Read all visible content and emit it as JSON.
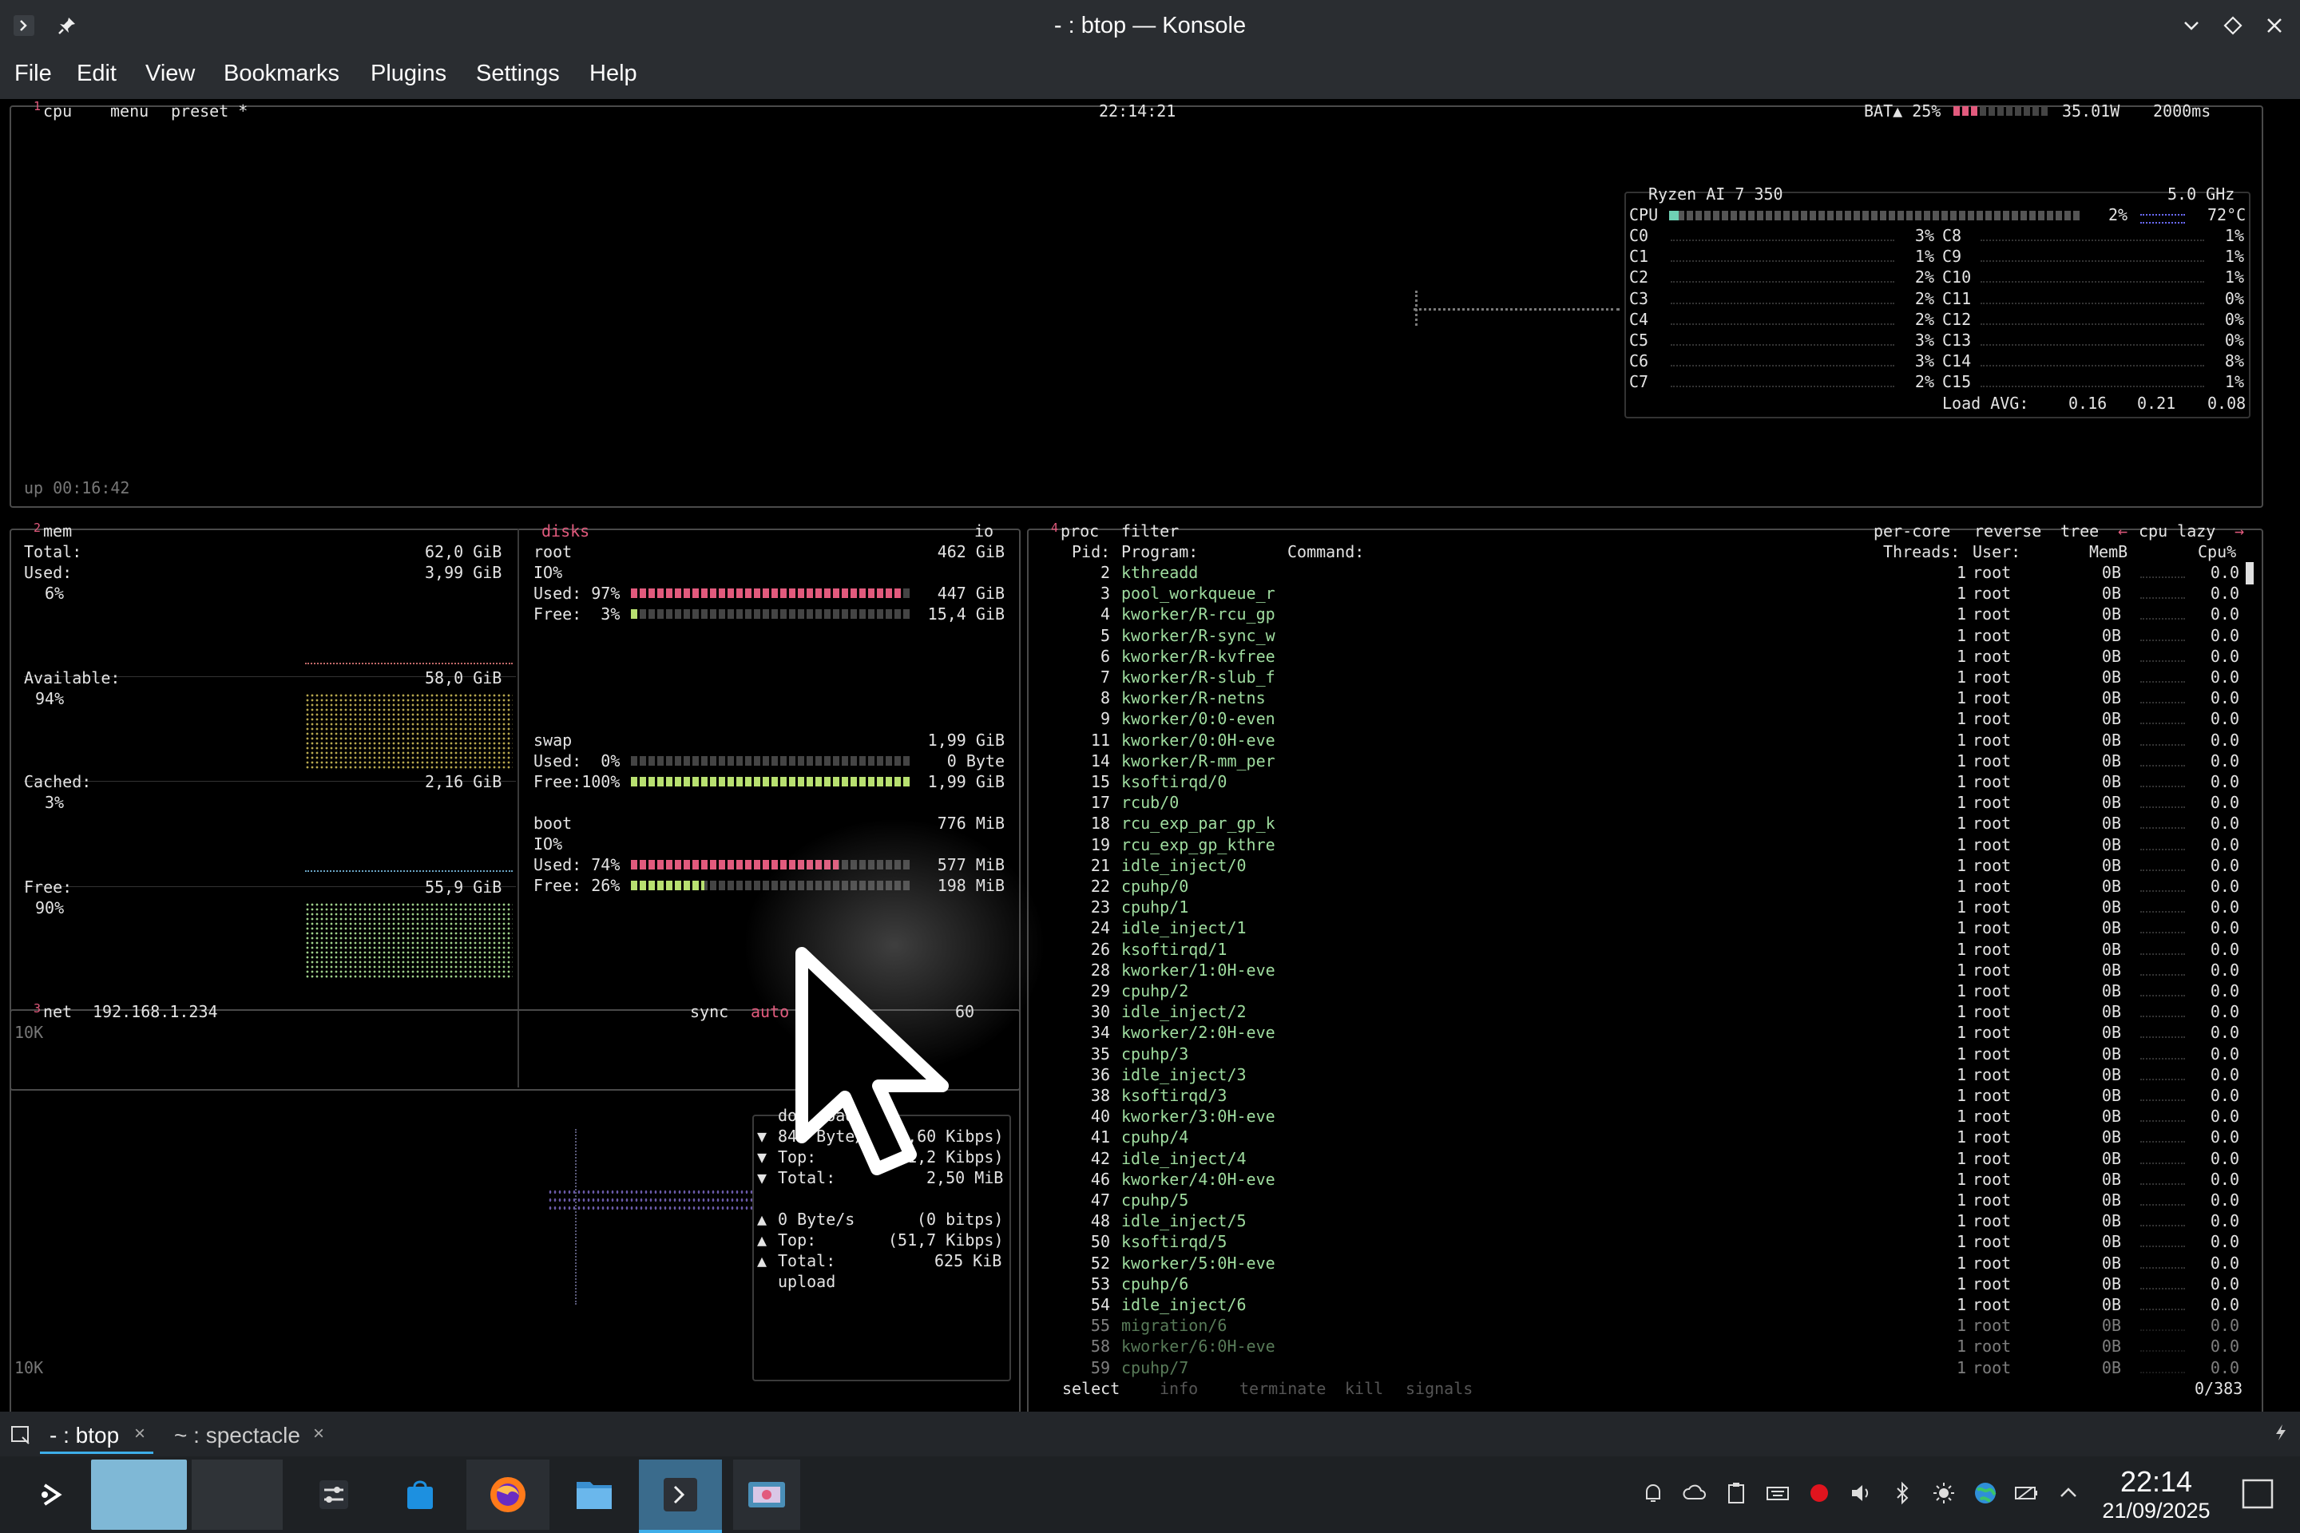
{
  "window": {
    "title": "- : btop — Konsole"
  },
  "menu": [
    "File",
    "Edit",
    "View",
    "Bookmarks",
    "Plugins",
    "Settings",
    "Help"
  ],
  "cpu": {
    "tab_num": "1",
    "tab": "cpu",
    "menu": "menu",
    "preset": "preset *",
    "clock": "22:14:21",
    "battery": "BAT▲ 25%",
    "battery_level": 0.25,
    "power": "35.01W",
    "interval": "2000ms",
    "uptime": "up 00:16:42",
    "model": "Ryzen AI 7 350",
    "freq": "5.0 GHz",
    "total_label": "CPU",
    "total_pct": "2%",
    "temp": "72°C",
    "cores_left": [
      {
        "name": "C0",
        "pct": "3%"
      },
      {
        "name": "C1",
        "pct": "1%"
      },
      {
        "name": "C2",
        "pct": "2%"
      },
      {
        "name": "C3",
        "pct": "2%"
      },
      {
        "name": "C4",
        "pct": "2%"
      },
      {
        "name": "C5",
        "pct": "3%"
      },
      {
        "name": "C6",
        "pct": "3%"
      },
      {
        "name": "C7",
        "pct": "2%"
      }
    ],
    "cores_right": [
      {
        "name": "C8",
        "pct": "1%"
      },
      {
        "name": "C9",
        "pct": "1%"
      },
      {
        "name": "C10",
        "pct": "1%"
      },
      {
        "name": "C11",
        "pct": "0%"
      },
      {
        "name": "C12",
        "pct": "0%"
      },
      {
        "name": "C13",
        "pct": "0%"
      },
      {
        "name": "C14",
        "pct": "8%"
      },
      {
        "name": "C15",
        "pct": "1%"
      }
    ],
    "load_label": "Load AVG:",
    "load": [
      "0.16",
      "0.21",
      "0.08"
    ]
  },
  "mem": {
    "tab_num": "2",
    "tab": "mem",
    "total_label": "Total:",
    "total": "62,0 GiB",
    "used_label": "Used:",
    "used": "3,99 GiB",
    "used_pct": "6%",
    "avail_label": "Available:",
    "avail": "58,0 GiB",
    "avail_pct": "94%",
    "cached_label": "Cached:",
    "cached": "2,16 GiB",
    "cached_pct": "3%",
    "free_label": "Free:",
    "free": "55,9 GiB",
    "free_pct": "90%"
  },
  "disks": {
    "tab": "disks",
    "io": "io",
    "root": {
      "name": "root",
      "size": "462 GiB",
      "io": "IO%",
      "used_label": "Used: 97%",
      "used": "447 GiB",
      "used_level": 0.97,
      "free_label": "Free:  3%",
      "free": "15,4 GiB",
      "free_level": 0.03
    },
    "swap": {
      "name": "swap",
      "size": "1,99 GiB",
      "used_label": "Used:  0%",
      "used": "0 Byte",
      "used_level": 0.0,
      "free_label": "Free:100%",
      "free": "1,99 GiB",
      "free_level": 1.0
    },
    "boot": {
      "name": "boot",
      "size": "776 MiB",
      "io": "IO%",
      "used_label": "Used: 74%",
      "used": "577 MiB",
      "used_level": 0.74,
      "free_label": "Free: 26%",
      "free": "198 MiB",
      "free_level": 0.26
    }
  },
  "net": {
    "tab_num": "3",
    "tab": "net",
    "ip": "192.168.1.234",
    "sync": "sync",
    "auto": "auto",
    "iface": "60",
    "scale_top": "10K",
    "scale_bottom": "10K",
    "download": {
      "label": "download",
      "rate": "845 Byte/s",
      "rate_bits": "(6,60 Kibps)",
      "top_label": "Top:",
      "top": "(31,2 Kibps)",
      "total_label": "Total:",
      "total": "2,50 MiB"
    },
    "upload": {
      "label": "upload",
      "rate": "0 Byte/s",
      "rate_bits": "(0 bitps)",
      "top_label": "Top:",
      "top": "(51,7 Kibps)",
      "total_label": "Total:",
      "total": "625 KiB"
    }
  },
  "proc": {
    "tab_num": "4",
    "tab": "proc",
    "filter": "filter",
    "per_core": "per-core",
    "reverse": "reverse",
    "tree": "tree",
    "sort": "cpu lazy",
    "headers": {
      "pid": "Pid:",
      "program": "Program:",
      "command": "Command:",
      "threads": "Threads:",
      "user": "User:",
      "mem": "MemB",
      "cpu": "Cpu%"
    },
    "rows": [
      {
        "pid": "2",
        "prog": "kthreadd",
        "thr": "1",
        "user": "root",
        "mem": "0B",
        "cpu": "0.0"
      },
      {
        "pid": "3",
        "prog": "pool_workqueue_r",
        "thr": "1",
        "user": "root",
        "mem": "0B",
        "cpu": "0.0"
      },
      {
        "pid": "4",
        "prog": "kworker/R-rcu_gp",
        "thr": "1",
        "user": "root",
        "mem": "0B",
        "cpu": "0.0"
      },
      {
        "pid": "5",
        "prog": "kworker/R-sync_w",
        "thr": "1",
        "user": "root",
        "mem": "0B",
        "cpu": "0.0"
      },
      {
        "pid": "6",
        "prog": "kworker/R-kvfree",
        "thr": "1",
        "user": "root",
        "mem": "0B",
        "cpu": "0.0"
      },
      {
        "pid": "7",
        "prog": "kworker/R-slub_f",
        "thr": "1",
        "user": "root",
        "mem": "0B",
        "cpu": "0.0"
      },
      {
        "pid": "8",
        "prog": "kworker/R-netns",
        "thr": "1",
        "user": "root",
        "mem": "0B",
        "cpu": "0.0"
      },
      {
        "pid": "9",
        "prog": "kworker/0:0-even",
        "thr": "1",
        "user": "root",
        "mem": "0B",
        "cpu": "0.0"
      },
      {
        "pid": "11",
        "prog": "kworker/0:0H-eve",
        "thr": "1",
        "user": "root",
        "mem": "0B",
        "cpu": "0.0"
      },
      {
        "pid": "14",
        "prog": "kworker/R-mm_per",
        "thr": "1",
        "user": "root",
        "mem": "0B",
        "cpu": "0.0"
      },
      {
        "pid": "15",
        "prog": "ksoftirqd/0",
        "thr": "1",
        "user": "root",
        "mem": "0B",
        "cpu": "0.0"
      },
      {
        "pid": "17",
        "prog": "rcub/0",
        "thr": "1",
        "user": "root",
        "mem": "0B",
        "cpu": "0.0"
      },
      {
        "pid": "18",
        "prog": "rcu_exp_par_gp_k",
        "thr": "1",
        "user": "root",
        "mem": "0B",
        "cpu": "0.0"
      },
      {
        "pid": "19",
        "prog": "rcu_exp_gp_kthre",
        "thr": "1",
        "user": "root",
        "mem": "0B",
        "cpu": "0.0"
      },
      {
        "pid": "21",
        "prog": "idle_inject/0",
        "thr": "1",
        "user": "root",
        "mem": "0B",
        "cpu": "0.0"
      },
      {
        "pid": "22",
        "prog": "cpuhp/0",
        "thr": "1",
        "user": "root",
        "mem": "0B",
        "cpu": "0.0"
      },
      {
        "pid": "23",
        "prog": "cpuhp/1",
        "thr": "1",
        "user": "root",
        "mem": "0B",
        "cpu": "0.0"
      },
      {
        "pid": "24",
        "prog": "idle_inject/1",
        "thr": "1",
        "user": "root",
        "mem": "0B",
        "cpu": "0.0"
      },
      {
        "pid": "26",
        "prog": "ksoftirqd/1",
        "thr": "1",
        "user": "root",
        "mem": "0B",
        "cpu": "0.0"
      },
      {
        "pid": "28",
        "prog": "kworker/1:0H-eve",
        "thr": "1",
        "user": "root",
        "mem": "0B",
        "cpu": "0.0"
      },
      {
        "pid": "29",
        "prog": "cpuhp/2",
        "thr": "1",
        "user": "root",
        "mem": "0B",
        "cpu": "0.0"
      },
      {
        "pid": "30",
        "prog": "idle_inject/2",
        "thr": "1",
        "user": "root",
        "mem": "0B",
        "cpu": "0.0"
      },
      {
        "pid": "34",
        "prog": "kworker/2:0H-eve",
        "thr": "1",
        "user": "root",
        "mem": "0B",
        "cpu": "0.0"
      },
      {
        "pid": "35",
        "prog": "cpuhp/3",
        "thr": "1",
        "user": "root",
        "mem": "0B",
        "cpu": "0.0"
      },
      {
        "pid": "36",
        "prog": "idle_inject/3",
        "thr": "1",
        "user": "root",
        "mem": "0B",
        "cpu": "0.0"
      },
      {
        "pid": "38",
        "prog": "ksoftirqd/3",
        "thr": "1",
        "user": "root",
        "mem": "0B",
        "cpu": "0.0"
      },
      {
        "pid": "40",
        "prog": "kworker/3:0H-eve",
        "thr": "1",
        "user": "root",
        "mem": "0B",
        "cpu": "0.0"
      },
      {
        "pid": "41",
        "prog": "cpuhp/4",
        "thr": "1",
        "user": "root",
        "mem": "0B",
        "cpu": "0.0"
      },
      {
        "pid": "42",
        "prog": "idle_inject/4",
        "thr": "1",
        "user": "root",
        "mem": "0B",
        "cpu": "0.0"
      },
      {
        "pid": "46",
        "prog": "kworker/4:0H-eve",
        "thr": "1",
        "user": "root",
        "mem": "0B",
        "cpu": "0.0"
      },
      {
        "pid": "47",
        "prog": "cpuhp/5",
        "thr": "1",
        "user": "root",
        "mem": "0B",
        "cpu": "0.0"
      },
      {
        "pid": "48",
        "prog": "idle_inject/5",
        "thr": "1",
        "user": "root",
        "mem": "0B",
        "cpu": "0.0"
      },
      {
        "pid": "50",
        "prog": "ksoftirqd/5",
        "thr": "1",
        "user": "root",
        "mem": "0B",
        "cpu": "0.0"
      },
      {
        "pid": "52",
        "prog": "kworker/5:0H-eve",
        "thr": "1",
        "user": "root",
        "mem": "0B",
        "cpu": "0.0"
      },
      {
        "pid": "53",
        "prog": "cpuhp/6",
        "thr": "1",
        "user": "root",
        "mem": "0B",
        "cpu": "0.0"
      },
      {
        "pid": "54",
        "prog": "idle_inject/6",
        "thr": "1",
        "user": "root",
        "mem": "0B",
        "cpu": "0.0"
      },
      {
        "pid": "55",
        "prog": "migration/6",
        "thr": "1",
        "user": "root",
        "mem": "0B",
        "cpu": "0.0"
      },
      {
        "pid": "58",
        "prog": "kworker/6:0H-eve",
        "thr": "1",
        "user": "root",
        "mem": "0B",
        "cpu": "0.0"
      },
      {
        "pid": "59",
        "prog": "cpuhp/7",
        "thr": "1",
        "user": "root",
        "mem": "0B",
        "cpu": "0.0"
      }
    ],
    "footer": {
      "select": "select",
      "info": "info",
      "terminate": "terminate",
      "kill": "kill",
      "signals": "signals",
      "count": "0/383"
    }
  },
  "tabs": [
    {
      "label": "- : btop"
    },
    {
      "label": "~ : spectacle"
    }
  ],
  "taskbar": {
    "time": "22:14",
    "date": "21/09/2025"
  },
  "colors": {
    "accent": "#e25a7d",
    "program": "#9fdc9f",
    "titlebar": "#2a2d31",
    "taskbar": "#1e2124",
    "active_task": "#3a6b8c"
  }
}
